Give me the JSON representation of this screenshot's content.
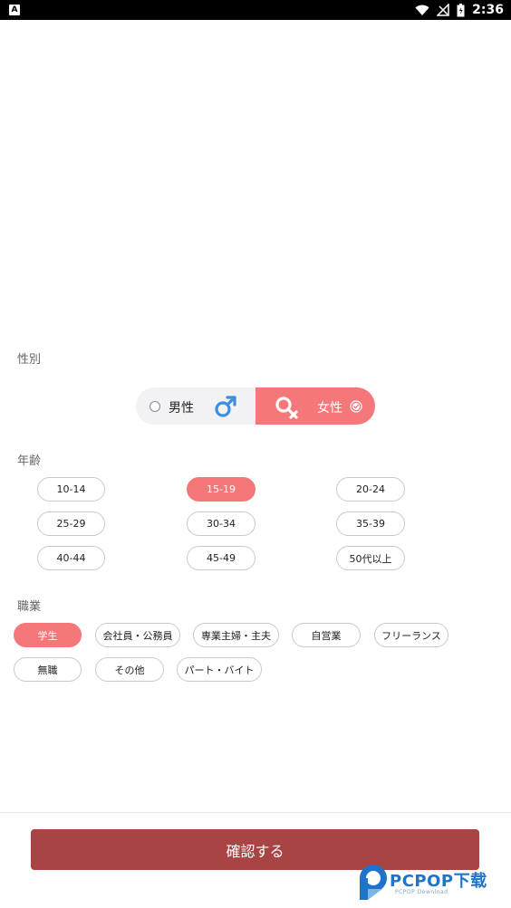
{
  "status_bar": {
    "app_badge": "A",
    "time": "2:36",
    "icons": [
      "wifi-icon",
      "signal-icon",
      "battery-icon"
    ]
  },
  "sections": {
    "gender_label": "性別",
    "age_label": "年齢",
    "job_label": "職業"
  },
  "gender": {
    "male_label": "男性",
    "female_label": "女性",
    "selected": "female"
  },
  "age_options": [
    "10-14",
    "15-19",
    "20-24",
    "25-29",
    "30-34",
    "35-39",
    "40-44",
    "45-49",
    "50代以上"
  ],
  "age_selected": "15-19",
  "job_options": [
    "学生",
    "会社員・公務員",
    "専業主婦・主夫",
    "自営業",
    "フリーランス",
    "無職",
    "その他",
    "パート・バイト"
  ],
  "job_selected": "学生",
  "confirm_label": "確認する",
  "watermark": {
    "brand": "PCPOP下载",
    "sub": "PCPOP Download"
  },
  "colors": {
    "accent": "#f47779",
    "confirm": "#a94445",
    "male_symbol": "#3d8fe0"
  }
}
